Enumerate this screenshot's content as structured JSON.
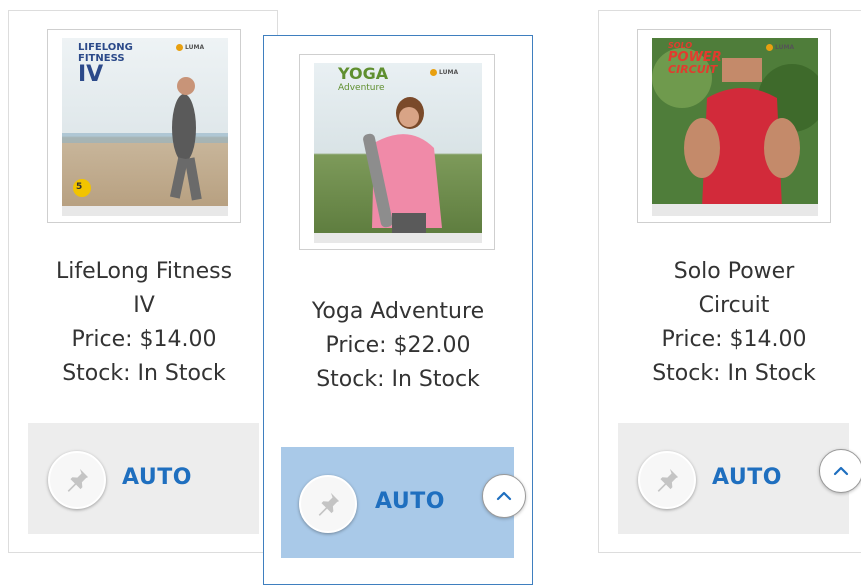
{
  "products": [
    {
      "name_line1": "LifeLong Fitness",
      "name_line2": "IV",
      "price": "Price: $14.00",
      "stock": "Stock: In Stock",
      "action_label": "AUTO",
      "cover": {
        "title_line1": "LIFELONG",
        "title_line2": "FITNESS",
        "title_line3": "IV",
        "badge": "5",
        "brand": "LUMA"
      }
    },
    {
      "name_line1": "Yoga Adventure",
      "price": "Price: $22.00",
      "stock": "Stock: In Stock",
      "action_label": "AUTO",
      "cover": {
        "title_line1": "YOGA",
        "title_line2": "Adventure",
        "brand": "LUMA"
      }
    },
    {
      "name_line1": "Solo Power",
      "name_line2": "Circuit",
      "price": "Price: $14.00",
      "stock": "Stock: In Stock",
      "action_label": "AUTO",
      "cover": {
        "title_line1": "SOLO",
        "title_line2": "POWER",
        "title_line3": "CIRCUIT",
        "brand": "LUMA"
      }
    }
  ],
  "colors": {
    "accent": "#1f6fbf",
    "selected_border": "#3f7fbf",
    "action_bar_default": "#ededed",
    "action_bar_selected": "#a9c9e8"
  }
}
